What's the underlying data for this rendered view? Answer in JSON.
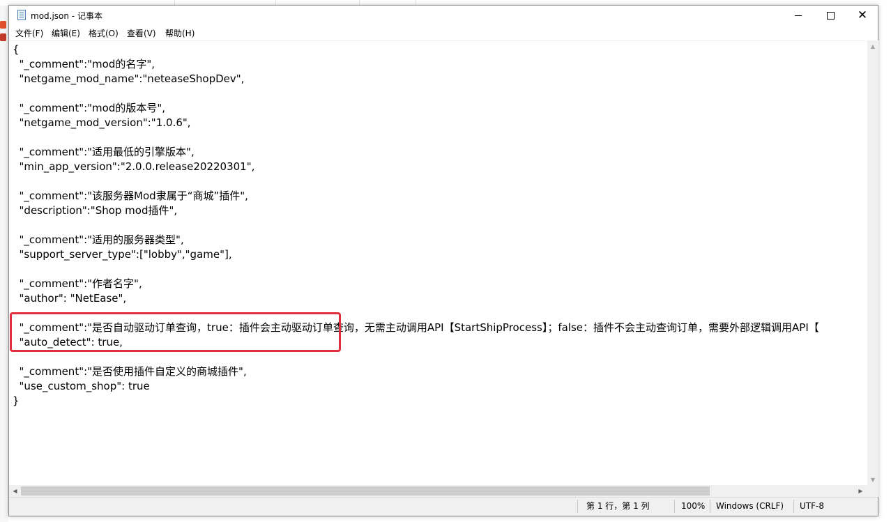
{
  "window": {
    "title": "mod.json - 记事本"
  },
  "menu": [
    {
      "label": "文件(F)"
    },
    {
      "label": "编辑(E)"
    },
    {
      "label": "格式(O)"
    },
    {
      "label": "查看(V)"
    },
    {
      "label": "帮助(H)"
    }
  ],
  "editor": {
    "lines": [
      "{",
      "  \"_comment\":\"mod的名字\",",
      "  \"netgame_mod_name\":\"neteaseShopDev\",",
      "",
      "  \"_comment\":\"mod的版本号\",",
      "  \"netgame_mod_version\":\"1.0.6\",",
      "",
      "  \"_comment\":\"适用最低的引擎版本\",",
      "  \"min_app_version\":\"2.0.0.release20220301\",",
      "",
      "  \"_comment\":\"该服务器Mod隶属于“商城”插件\",",
      "  \"description\":\"Shop mod插件\",",
      "",
      "  \"_comment\":\"适用的服务器类型\",",
      "  \"support_server_type\":[\"lobby\",\"game\"],",
      "",
      "  \"_comment\":\"作者名字\",",
      "  \"author\": \"NetEase\",",
      "",
      "  \"_comment\":\"是否自动驱动订单查询，true：插件会主动驱动订单查询，无需主动调用API【StartShipProcess】；false：插件不会主动查询订单，需要外部逻辑调用API【",
      "  \"auto_detect\": true,",
      "",
      "  \"_comment\":\"是否使用插件自定义的商城插件\",",
      "  \"use_custom_shop\": true",
      "}"
    ]
  },
  "status": {
    "position": "第 1 行，第 1 列",
    "zoom": "100%",
    "line_ending": "Windows (CRLF)",
    "encoding": "UTF-8"
  },
  "colors": {
    "highlight": "#e0303f"
  }
}
